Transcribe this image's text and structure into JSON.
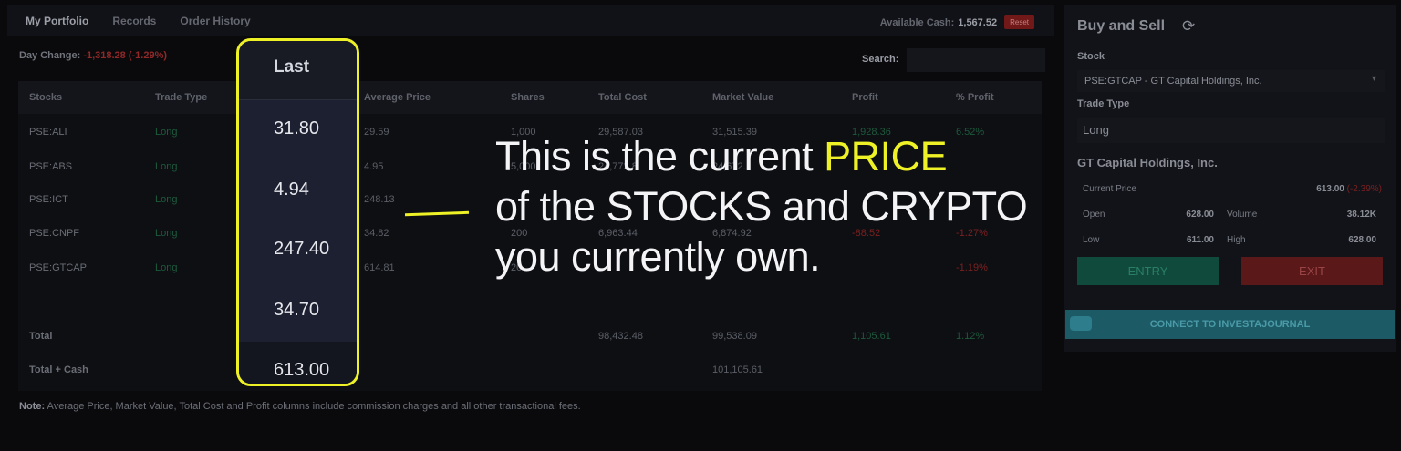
{
  "tabs": [
    "My Portfolio",
    "Records",
    "Order History"
  ],
  "cash": {
    "label": "Available Cash:",
    "value": "1,567.52",
    "reset": "Reset"
  },
  "day_change": {
    "label": "Day Change:",
    "value": "-1,318.28 (-1.29%)"
  },
  "search": {
    "label": "Search:",
    "value": ""
  },
  "table": {
    "headers": [
      "Stocks",
      "Trade Type",
      "Last",
      "Average Price",
      "Shares",
      "Total Cost",
      "Market Value",
      "Profit",
      "% Profit"
    ],
    "rows": [
      {
        "stock": "PSE:ALI",
        "type": "Long",
        "last": "31.80",
        "avg": "29.59",
        "shares": "1,000",
        "cost": "29,587.03",
        "market": "31,515.39",
        "profit": "1,928.36",
        "pct": "6.52%"
      },
      {
        "stock": "PSE:ABS",
        "type": "Long",
        "last": "4.94",
        "avg": "4.95",
        "shares": "5,000",
        "cost": "24,772.8",
        "market": "24,672.",
        "profit": "",
        "pct": ""
      },
      {
        "stock": "PSE:ICT",
        "type": "Long",
        "last": "247.40",
        "avg": "248.13",
        "shares": "",
        "cost": "",
        "market": "",
        "profit": "",
        "pct": ""
      },
      {
        "stock": "PSE:CNPF",
        "type": "Long",
        "last": "34.70",
        "avg": "34.82",
        "shares": "200",
        "cost": "6,963.44",
        "market": "6,874.92",
        "profit": "-88.52",
        "pct": "-1.27%"
      },
      {
        "stock": "PSE:GTCAP",
        "type": "Long",
        "last": "613.00",
        "avg": "614.81",
        "shares": "20",
        "cost": "",
        "market": "",
        "profit": "",
        "pct": "-1.19%"
      }
    ],
    "total": {
      "label": "Total",
      "cost": "98,432.48",
      "market": "99,538.09",
      "profit": "1,105.61",
      "pct": "1.12%"
    },
    "total_cash": {
      "label": "Total + Cash",
      "market": "101,105.61"
    }
  },
  "note": {
    "bold": "Note:",
    "text": " Average Price, Market Value, Total Cost and Profit columns include commission charges and all other transactional fees."
  },
  "annotation": {
    "line1_a": "This is the current ",
    "line1_hl": "PRICE",
    "line2": "of the STOCKS and CRYPTO",
    "line3": "you currently own."
  },
  "buy_sell": {
    "title": "Buy and Sell",
    "refresh_icon": "refresh-icon",
    "stock_label": "Stock",
    "stock_value": "PSE:GTCAP - GT Capital Holdings, Inc.",
    "trade_type_label": "Trade Type",
    "trade_type_value": "Long",
    "company": "GT Capital Holdings, Inc.",
    "current_price_label": "Current Price",
    "current_price": "613.00",
    "current_change": "(-2.39%)",
    "open_label": "Open",
    "open": "628.00",
    "volume_label": "Volume",
    "volume": "38.12K",
    "low_label": "Low",
    "low": "611.00",
    "high_label": "High",
    "high": "628.00",
    "entry": "ENTRY",
    "exit": "EXIT",
    "connect": "CONNECT TO INVESTAJOURNAL"
  },
  "colors": {
    "highlight": "#eef126",
    "positive": "#1d5a3c",
    "negative": "#9c2b2b"
  }
}
